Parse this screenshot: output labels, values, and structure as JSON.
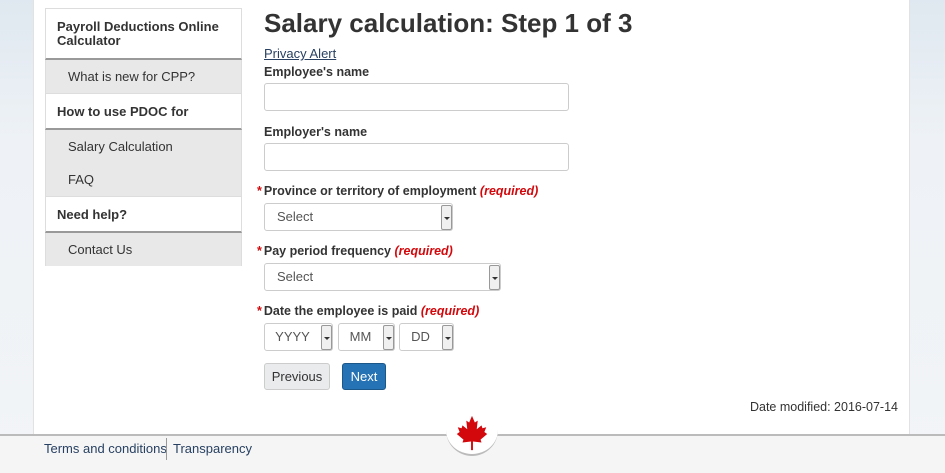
{
  "sidebar": {
    "title": "Payroll Deductions Online Calculator",
    "item_cpp": "What is new for CPP?",
    "group_howto": "How to use PDOC for",
    "item_salary": "Salary Calculation",
    "item_faq": "FAQ",
    "group_help": "Need help?",
    "item_contact": "Contact Us"
  },
  "main": {
    "title": "Salary calculation: Step 1 of 3",
    "privacy_link": "Privacy Alert",
    "employee_label": "Employee's name",
    "employee_value": "",
    "employer_label": "Employer's name",
    "employer_value": "",
    "province_label": "Province or territory of employment",
    "province_value": "Select",
    "payperiod_label": "Pay period frequency",
    "payperiod_value": "Select",
    "date_label": "Date the employee is paid",
    "date_year": "YYYY",
    "date_month": "MM",
    "date_day": "DD",
    "required_text": "(required)",
    "required_star": "*",
    "previous_button": "Previous",
    "next_button": "Next",
    "modified": "Date modified: 2016-07-14"
  },
  "footer": {
    "terms": "Terms and conditions",
    "transparency": "Transparency"
  },
  "colors": {
    "accent": "#2572b4",
    "required": "#d3080c",
    "maple_leaf": "#d3080c"
  }
}
